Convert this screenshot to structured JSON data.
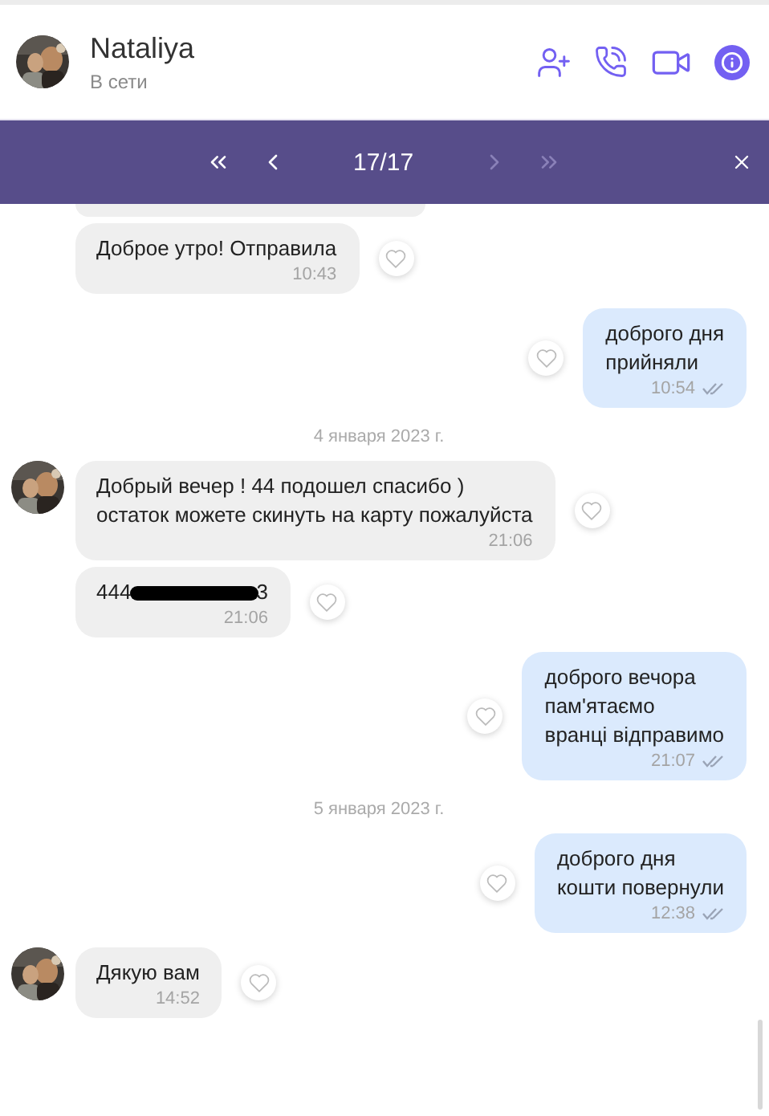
{
  "contact": {
    "name": "Nataliya",
    "status": "В сети"
  },
  "search_bar": {
    "counter": "17/17",
    "buttons": [
      {
        "kind": "first",
        "disabled": false
      },
      {
        "kind": "prev",
        "disabled": false
      },
      {
        "kind": "counter"
      },
      {
        "kind": "next",
        "disabled": true
      },
      {
        "kind": "last",
        "disabled": true
      },
      {
        "kind": "close"
      }
    ]
  },
  "messages": [
    {
      "kind": "incoming",
      "avatar": false,
      "lines": [
        "Доброе утро! Отправила"
      ],
      "time": "10:43"
    },
    {
      "kind": "outgoing",
      "lines": [
        "доброго дня",
        "прийняли"
      ],
      "time": "10:54"
    },
    {
      "kind": "date",
      "text": "4 января 2023 г."
    },
    {
      "kind": "incoming",
      "avatar": true,
      "lines": [
        "Добрый вечер ! 44 подошел спасибо )",
        "остаток можете скинуть на карту пожалуйста"
      ],
      "time": "21:06"
    },
    {
      "kind": "incoming",
      "avatar": false,
      "lines": [
        "444"
      ],
      "redacted_tail": "3",
      "time": "21:06"
    },
    {
      "kind": "outgoing",
      "lines": [
        "доброго вечора",
        "пам'ятаємо",
        "вранці відправимо"
      ],
      "time": "21:07"
    },
    {
      "kind": "date",
      "text": "5 января 2023 г."
    },
    {
      "kind": "outgoing",
      "lines": [
        "доброго дня",
        "кошти повернули"
      ],
      "time": "12:38"
    },
    {
      "kind": "incoming",
      "avatar": true,
      "lines": [
        "Дякую вам"
      ],
      "time": "14:52"
    }
  ]
}
